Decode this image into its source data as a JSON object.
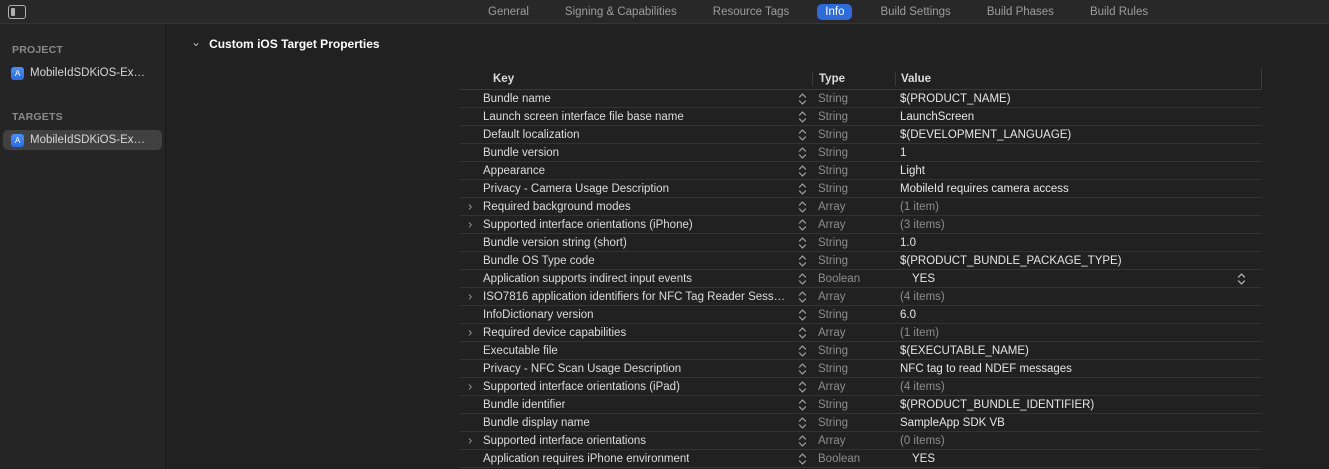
{
  "colors": {
    "accent": "#2e6bd8"
  },
  "topbar": {
    "tabs": [
      "General",
      "Signing & Capabilities",
      "Resource Tags",
      "Info",
      "Build Settings",
      "Build Phases",
      "Build Rules"
    ],
    "selected_tab": "Info"
  },
  "sidebar": {
    "sections": [
      {
        "header": "PROJECT",
        "items": [
          {
            "label": "MobileIdSDKiOS-Ex…",
            "selected": false
          }
        ]
      },
      {
        "header": "TARGETS",
        "items": [
          {
            "label": "MobileIdSDKiOS-Ex…",
            "selected": true
          }
        ]
      }
    ],
    "app_icon_glyph": "A"
  },
  "main": {
    "section_title": "Custom iOS Target Properties",
    "table": {
      "columns": [
        "Key",
        "Type",
        "Value"
      ],
      "rows": [
        {
          "key": "Bundle name",
          "type": "String",
          "value": "$(PRODUCT_NAME)",
          "disclosure": false,
          "value_muted": false,
          "value_indent": false,
          "popup": false
        },
        {
          "key": "Launch screen interface file base name",
          "type": "String",
          "value": "LaunchScreen",
          "disclosure": false,
          "value_muted": false,
          "value_indent": false,
          "popup": false
        },
        {
          "key": "Default localization",
          "type": "String",
          "value": "$(DEVELOPMENT_LANGUAGE)",
          "disclosure": false,
          "value_muted": false,
          "value_indent": false,
          "popup": false
        },
        {
          "key": "Bundle version",
          "type": "String",
          "value": "1",
          "disclosure": false,
          "value_muted": false,
          "value_indent": false,
          "popup": false
        },
        {
          "key": "Appearance",
          "type": "String",
          "value": "Light",
          "disclosure": false,
          "value_muted": false,
          "value_indent": false,
          "popup": false
        },
        {
          "key": "Privacy - Camera Usage Description",
          "type": "String",
          "value": "MobileId requires camera access",
          "disclosure": false,
          "value_muted": false,
          "value_indent": false,
          "popup": false
        },
        {
          "key": "Required background modes",
          "type": "Array",
          "value": "(1 item)",
          "disclosure": true,
          "value_muted": true,
          "value_indent": false,
          "popup": false
        },
        {
          "key": "Supported interface orientations (iPhone)",
          "type": "Array",
          "value": "(3 items)",
          "disclosure": true,
          "value_muted": true,
          "value_indent": false,
          "popup": false
        },
        {
          "key": "Bundle version string (short)",
          "type": "String",
          "value": "1.0",
          "disclosure": false,
          "value_muted": false,
          "value_indent": false,
          "popup": false
        },
        {
          "key": "Bundle OS Type code",
          "type": "String",
          "value": "$(PRODUCT_BUNDLE_PACKAGE_TYPE)",
          "disclosure": false,
          "value_muted": false,
          "value_indent": false,
          "popup": false
        },
        {
          "key": "Application supports indirect input events",
          "type": "Boolean",
          "value": "YES",
          "disclosure": false,
          "value_muted": false,
          "value_indent": true,
          "popup": true
        },
        {
          "key": "ISO7816 application identifiers for NFC Tag Reader Sess…",
          "type": "Array",
          "value": "(4 items)",
          "disclosure": true,
          "value_muted": true,
          "value_indent": false,
          "popup": false
        },
        {
          "key": "InfoDictionary version",
          "type": "String",
          "value": "6.0",
          "disclosure": false,
          "value_muted": false,
          "value_indent": false,
          "popup": false
        },
        {
          "key": "Required device capabilities",
          "type": "Array",
          "value": "(1 item)",
          "disclosure": true,
          "value_muted": true,
          "value_indent": false,
          "popup": false
        },
        {
          "key": "Executable file",
          "type": "String",
          "value": "$(EXECUTABLE_NAME)",
          "disclosure": false,
          "value_muted": false,
          "value_indent": false,
          "popup": false
        },
        {
          "key": "Privacy - NFC Scan Usage Description",
          "type": "String",
          "value": "NFC tag to read NDEF messages",
          "disclosure": false,
          "value_muted": false,
          "value_indent": false,
          "popup": false
        },
        {
          "key": "Supported interface orientations (iPad)",
          "type": "Array",
          "value": "(4 items)",
          "disclosure": true,
          "value_muted": true,
          "value_indent": false,
          "popup": false
        },
        {
          "key": "Bundle identifier",
          "type": "String",
          "value": "$(PRODUCT_BUNDLE_IDENTIFIER)",
          "disclosure": false,
          "value_muted": false,
          "value_indent": false,
          "popup": false
        },
        {
          "key": "Bundle display name",
          "type": "String",
          "value": "SampleApp SDK VB",
          "disclosure": false,
          "value_muted": false,
          "value_indent": false,
          "popup": false
        },
        {
          "key": "Supported interface orientations",
          "type": "Array",
          "value": "(0 items)",
          "disclosure": true,
          "value_muted": true,
          "value_indent": false,
          "popup": false
        },
        {
          "key": "Application requires iPhone environment",
          "type": "Boolean",
          "value": "YES",
          "disclosure": false,
          "value_muted": false,
          "value_indent": true,
          "popup": false
        }
      ]
    }
  }
}
